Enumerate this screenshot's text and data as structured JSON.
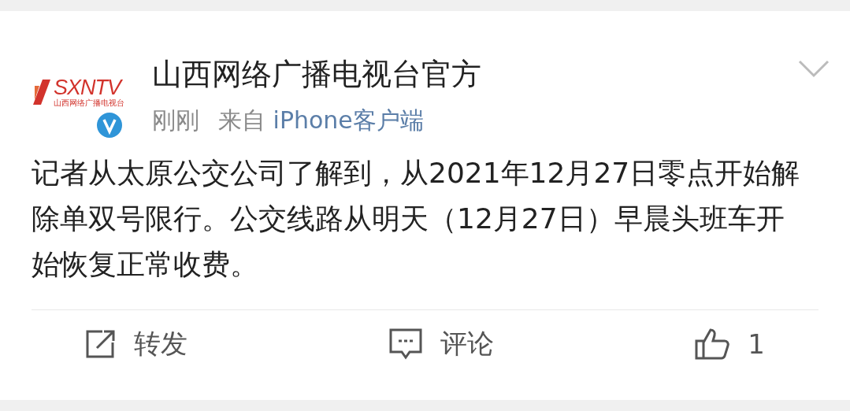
{
  "post": {
    "author": "山西网络广播电视台官方",
    "verified": true,
    "logo": {
      "mark": "SXNTV",
      "subtitle": "山西网络广播电视台"
    },
    "time": "刚刚",
    "source_prefix": "来自",
    "source": "iPhone客户端",
    "text": "记者从太原公交公司了解到，从2021年12月27日零点开始解除单双号限行。公交线路从明天（12月27日）早晨头班车开始恢复正常收费。",
    "actions": [
      {
        "kind": "repost",
        "label": "转发"
      },
      {
        "kind": "comment",
        "label": "评论"
      },
      {
        "kind": "like",
        "label": "1"
      }
    ]
  }
}
